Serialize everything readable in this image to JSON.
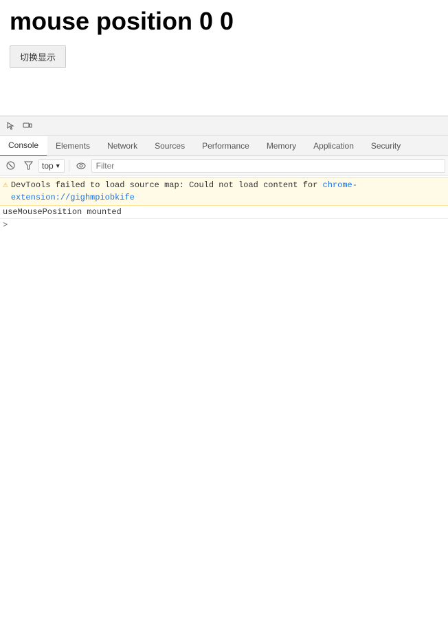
{
  "page": {
    "title": "mouse position 0 0",
    "toggle_button_label": "切换显示"
  },
  "devtools": {
    "tabs": [
      {
        "id": "console",
        "label": "Console",
        "active": true
      },
      {
        "id": "elements",
        "label": "Elements",
        "active": false
      },
      {
        "id": "network",
        "label": "Network",
        "active": false
      },
      {
        "id": "sources",
        "label": "Sources",
        "active": false
      },
      {
        "id": "performance",
        "label": "Performance",
        "active": false
      },
      {
        "id": "memory",
        "label": "Memory",
        "active": false
      },
      {
        "id": "application",
        "label": "Application",
        "active": false
      },
      {
        "id": "security",
        "label": "Security",
        "active": false
      }
    ],
    "console": {
      "context": "top",
      "filter_placeholder": "Filter",
      "warning_message": "DevTools failed to load source map: Could not load content for ",
      "warning_link": "chrome-extension://gighmpiobkife",
      "log_message": "useMousePosition mounted",
      "prompt_symbol": ">"
    }
  }
}
